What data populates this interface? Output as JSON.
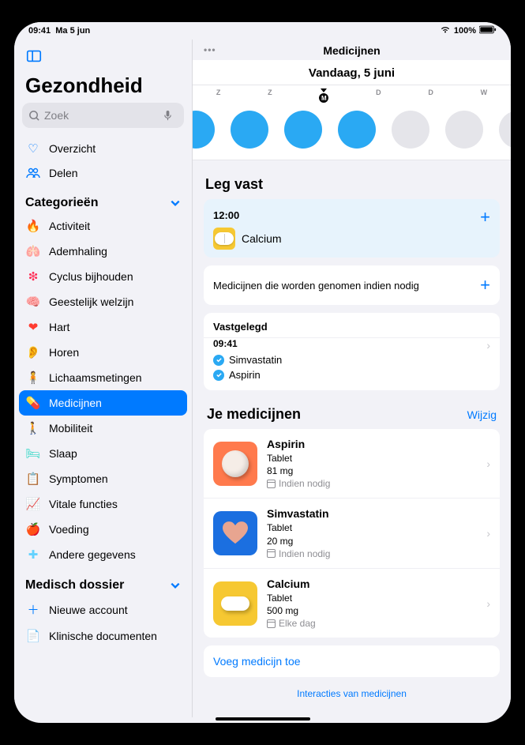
{
  "statusbar": {
    "time": "09:41",
    "date": "Ma 5 jun",
    "battery": "100%"
  },
  "sidebar": {
    "title": "Gezondheid",
    "search_placeholder": "Zoek",
    "overview": "Overzicht",
    "sharing": "Delen",
    "categories_head": "Categorieën",
    "items": [
      {
        "label": "Activiteit",
        "icon": "🔥",
        "color": "#ff3b30"
      },
      {
        "label": "Ademhaling",
        "icon": "🫁",
        "color": "#5ac8fa"
      },
      {
        "label": "Cyclus bijhouden",
        "icon": "❇︎",
        "color": "#ff2d55"
      },
      {
        "label": "Geestelijk welzijn",
        "icon": "🧠",
        "color": "#34c789"
      },
      {
        "label": "Hart",
        "icon": "❤︎",
        "color": "#ff3b30"
      },
      {
        "label": "Horen",
        "icon": "👂",
        "color": "#147efb"
      },
      {
        "label": "Lichaamsmetingen",
        "icon": "🧍",
        "color": "#af52de"
      },
      {
        "label": "Medicijnen",
        "icon": "💊",
        "color": "#34aadc",
        "active": true
      },
      {
        "label": "Mobiliteit",
        "icon": "🚶",
        "color": "#ff9500"
      },
      {
        "label": "Slaap",
        "icon": "🛏",
        "color": "#2fd6c4"
      },
      {
        "label": "Symptomen",
        "icon": "📋",
        "color": "#8e8e93"
      },
      {
        "label": "Vitale functies",
        "icon": "📈",
        "color": "#ff3b30"
      },
      {
        "label": "Voeding",
        "icon": "🍎",
        "color": "#32d74b"
      },
      {
        "label": "Andere gegevens",
        "icon": "✚",
        "color": "#64d2ff"
      }
    ],
    "records_head": "Medisch dossier",
    "records": [
      {
        "label": "Nieuwe account",
        "icon": "＋",
        "color": "#007aff"
      },
      {
        "label": "Klinische documenten",
        "icon": "📄",
        "color": "#8e8e93"
      }
    ]
  },
  "main": {
    "header": "Medicijnen",
    "date_line": "Vandaag, 5 juni",
    "weekdays": [
      "Z",
      "Z",
      "M",
      "D",
      "D",
      "W"
    ],
    "log_section": "Leg vast",
    "schedule_time": "12:00",
    "schedule_med": "Calcium",
    "as_needed": "Medicijnen die worden genomen indien nodig",
    "logged_head": "Vastgelegd",
    "logged_time": "09:41",
    "logged_items": [
      "Simvastatin",
      "Aspirin"
    ],
    "your_meds_head": "Je medicijnen",
    "edit": "Wijzig",
    "meds": [
      {
        "name": "Aspirin",
        "form": "Tablet",
        "dose": "81 mg",
        "schedule": "Indien nodig",
        "tile": "orange",
        "shape": "tablet"
      },
      {
        "name": "Simvastatin",
        "form": "Tablet",
        "dose": "20 mg",
        "schedule": "Indien nodig",
        "tile": "blue",
        "shape": "heart"
      },
      {
        "name": "Calcium",
        "form": "Tablet",
        "dose": "500 mg",
        "schedule": "Elke dag",
        "tile": "yellow",
        "shape": "capsule"
      }
    ],
    "add_med": "Voeg medicijn toe",
    "bottom_link": "Interacties van medicijnen"
  }
}
